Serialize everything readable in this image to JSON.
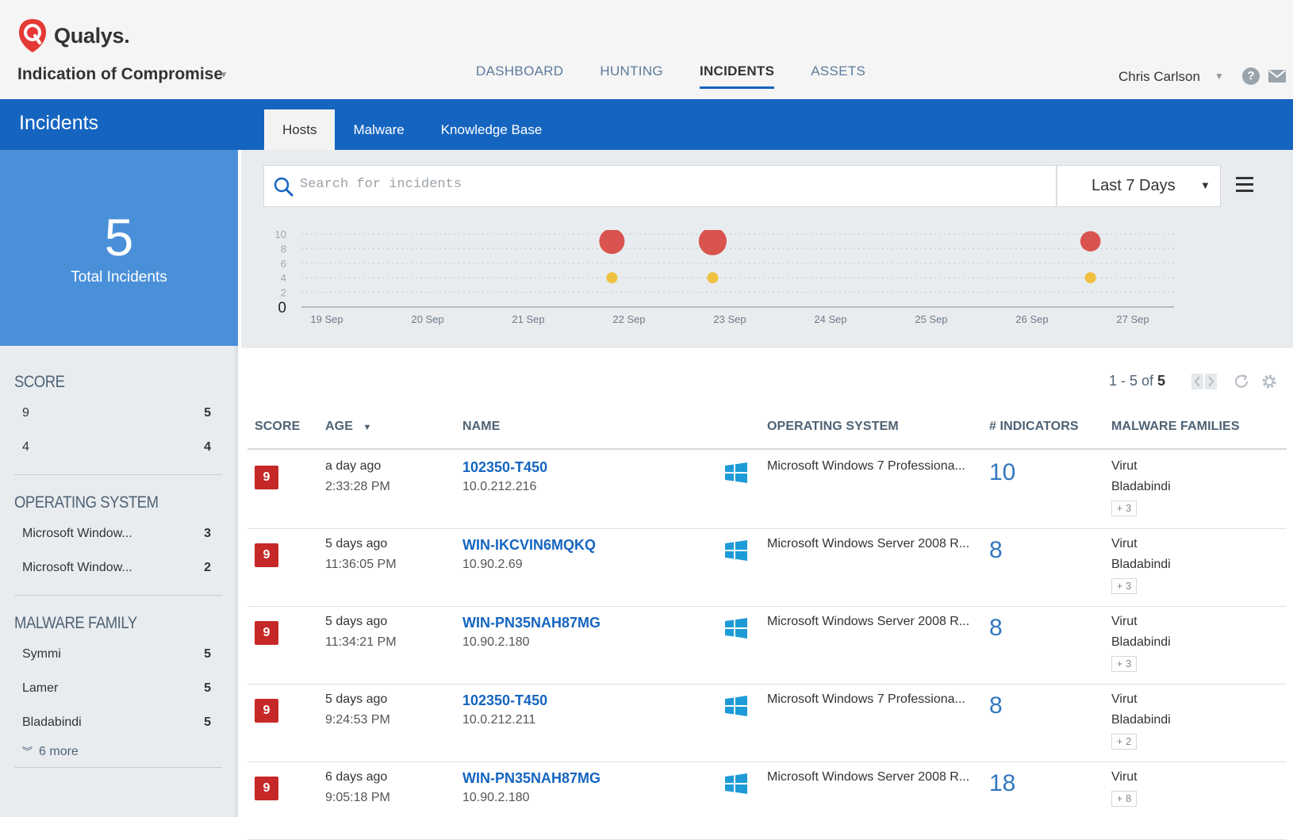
{
  "brand": {
    "logo_text": "Qualys.",
    "accent": "#1565c0",
    "danger": "#c62828"
  },
  "app": {
    "name": "Indication of Compromise"
  },
  "topnav": [
    "DASHBOARD",
    "HUNTING",
    "INCIDENTS",
    "ASSETS"
  ],
  "user": {
    "name": "Chris Carlson"
  },
  "section": {
    "title": "Incidents",
    "tabs": [
      "Hosts",
      "Malware",
      "Knowledge Base"
    ]
  },
  "summary": {
    "total": "5",
    "label": "Total Incidents"
  },
  "filters": {
    "score": {
      "title": "SCORE",
      "items": [
        {
          "label": "9",
          "count": "5"
        },
        {
          "label": "4",
          "count": "4"
        }
      ]
    },
    "os": {
      "title": "OPERATING SYSTEM",
      "items": [
        {
          "label": "Microsoft Window...",
          "count": "3"
        },
        {
          "label": "Microsoft Window...",
          "count": "2"
        }
      ]
    },
    "malware": {
      "title": "MALWARE FAMILY",
      "items": [
        {
          "label": "Symmi",
          "count": "5"
        },
        {
          "label": "Lamer",
          "count": "5"
        },
        {
          "label": "Bladabindi",
          "count": "5"
        }
      ],
      "more": "6 more"
    }
  },
  "search": {
    "placeholder": "Search for incidents",
    "range": "Last 7 Days"
  },
  "chart_data": {
    "type": "scatter",
    "x_categories": [
      "19 Sep",
      "20 Sep",
      "21 Sep",
      "22 Sep",
      "23 Sep",
      "24 Sep",
      "25 Sep",
      "26 Sep",
      "27 Sep"
    ],
    "y_ticks": [
      "0",
      "2",
      "4",
      "6",
      "8",
      "10"
    ],
    "ylim": [
      0,
      10
    ],
    "grid": true,
    "series": [
      {
        "color": "#d9534f",
        "points": [
          {
            "x": 2.83,
            "y": 9,
            "size": 1.0
          },
          {
            "x": 3.83,
            "y": 9,
            "size": 1.1
          },
          {
            "x": 7.58,
            "y": 9,
            "size": 0.8
          }
        ]
      },
      {
        "color": "#f0c040",
        "points": [
          {
            "x": 2.83,
            "y": 4
          },
          {
            "x": 3.83,
            "y": 4
          },
          {
            "x": 7.58,
            "y": 4
          }
        ]
      }
    ]
  },
  "pager": {
    "range": "1 - 5 of",
    "total": "5"
  },
  "table": {
    "headers": {
      "score": "SCORE",
      "age": "AGE",
      "name": "NAME",
      "os": "OPERATING SYSTEM",
      "indicators": "# INDICATORS",
      "families": "MALWARE FAMILIES"
    },
    "rows": [
      {
        "score": "9",
        "age": "a day ago",
        "time": "2:33:28 PM",
        "host": "102350-T450",
        "ip": "10.0.212.216",
        "os": "Microsoft Windows 7 Professiona...",
        "indicators": "10",
        "fam1": "Virut",
        "fam2": "Bladabindi",
        "more": "+ 3"
      },
      {
        "score": "9",
        "age": "5 days ago",
        "time": "11:36:05 PM",
        "host": "WIN-IKCVIN6MQKQ",
        "ip": "10.90.2.69",
        "os": "Microsoft Windows Server 2008 R...",
        "indicators": "8",
        "fam1": "Virut",
        "fam2": "Bladabindi",
        "more": "+ 3"
      },
      {
        "score": "9",
        "age": "5 days ago",
        "time": "11:34:21 PM",
        "host": "WIN-PN35NAH87MG",
        "ip": "10.90.2.180",
        "os": "Microsoft Windows Server 2008 R...",
        "indicators": "8",
        "fam1": "Virut",
        "fam2": "Bladabindi",
        "more": "+ 3"
      },
      {
        "score": "9",
        "age": "5 days ago",
        "time": "9:24:53 PM",
        "host": "102350-T450",
        "ip": "10.0.212.211",
        "os": "Microsoft Windows 7 Professiona...",
        "indicators": "8",
        "fam1": "Virut",
        "fam2": "Bladabindi",
        "more": "+ 2"
      },
      {
        "score": "9",
        "age": "6 days ago",
        "time": "9:05:18 PM",
        "host": "WIN-PN35NAH87MG",
        "ip": "10.90.2.180",
        "os": "Microsoft Windows Server 2008 R...",
        "indicators": "18",
        "fam1": "Virut",
        "fam2": "",
        "more": "+ 8"
      }
    ]
  }
}
